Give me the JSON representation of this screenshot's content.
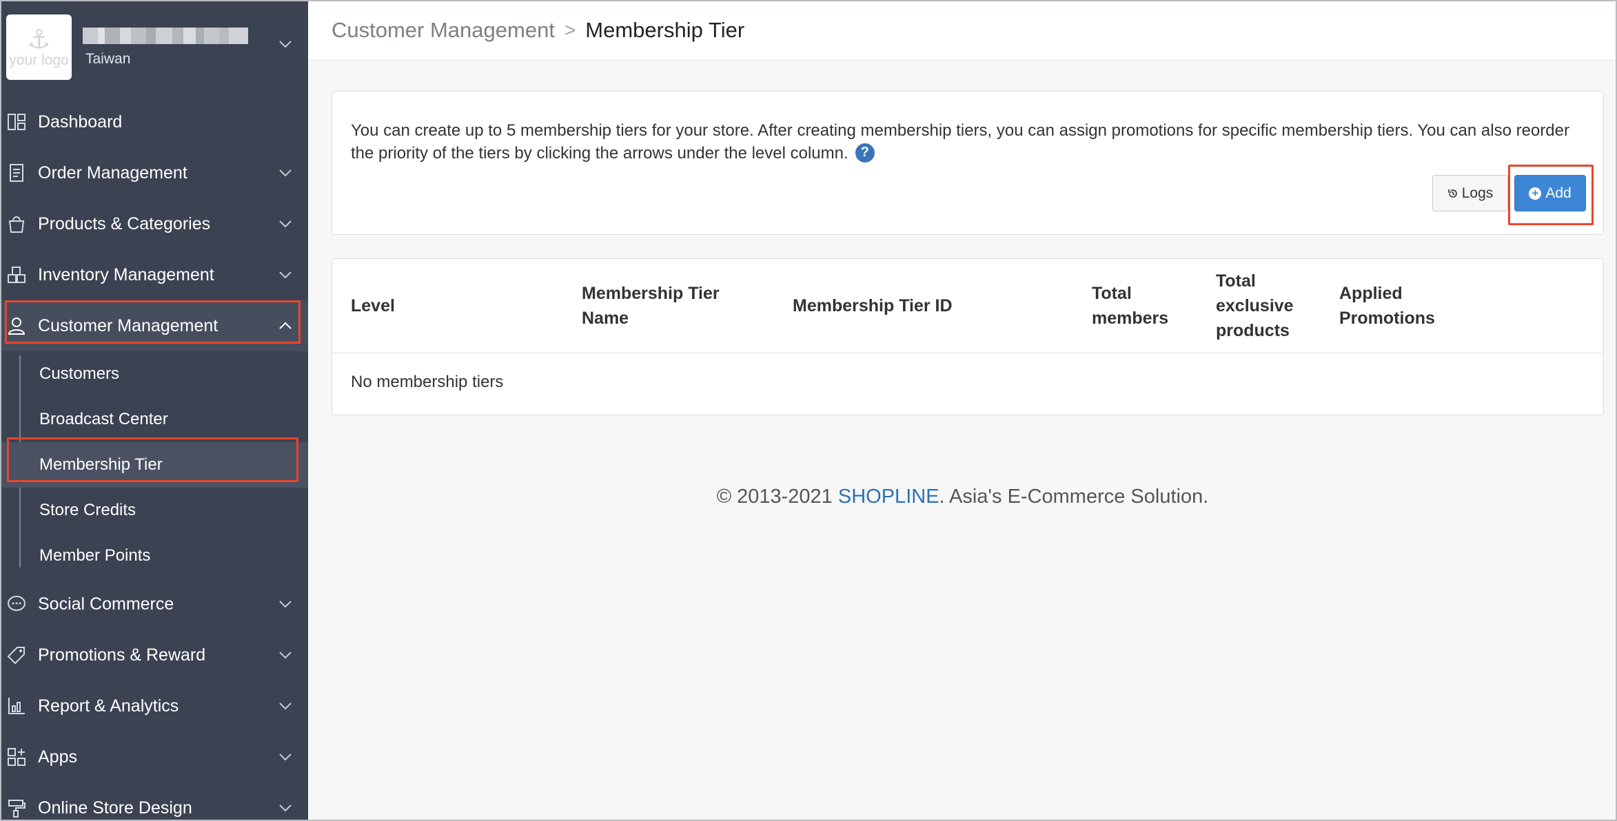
{
  "sidebar": {
    "logo_text": "your logo",
    "store_region": "Taiwan",
    "items": [
      {
        "label": "Dashboard",
        "icon": "dashboard-icon"
      },
      {
        "label": "Order Management",
        "icon": "order-icon"
      },
      {
        "label": "Products & Categories",
        "icon": "shopping-bag-icon"
      },
      {
        "label": "Inventory Management",
        "icon": "inventory-icon"
      },
      {
        "label": "Customer Management",
        "icon": "user-icon"
      },
      {
        "label": "Social Commerce",
        "icon": "chat-icon"
      },
      {
        "label": "Promotions & Reward",
        "icon": "tag-icon"
      },
      {
        "label": "Report & Analytics",
        "icon": "chart-icon"
      },
      {
        "label": "Apps",
        "icon": "apps-icon"
      },
      {
        "label": "Online Store Design",
        "icon": "paint-roller-icon"
      }
    ],
    "customer_submenu": [
      {
        "label": "Customers"
      },
      {
        "label": "Broadcast Center"
      },
      {
        "label": "Membership Tier"
      },
      {
        "label": "Store Credits"
      },
      {
        "label": "Member Points"
      }
    ]
  },
  "breadcrumb": {
    "parent": "Customer Management",
    "separator": ">",
    "current": "Membership Tier"
  },
  "info": {
    "text": "You can create up to 5 membership tiers for your store. After creating membership tiers, you can assign promotions for specific membership tiers. You can also reorder the priority of the tiers by clicking the arrows under the level column.",
    "help_symbol": "?",
    "logs_label": "Logs",
    "add_label": "Add"
  },
  "table": {
    "headers": [
      "Level",
      "Membership Tier Name",
      "Membership Tier ID",
      "Total members",
      "Total exclusive products",
      "Applied Promotions"
    ],
    "empty_text": "No membership tiers"
  },
  "footer": {
    "prefix": "© 2013-2021 ",
    "brand": "SHOPLINE",
    "suffix": ". Asia's E-Commerce Solution."
  },
  "colors": {
    "sidebar_bg": "#3b4252",
    "accent_blue": "#3d86d6",
    "highlight_red": "#e8452c"
  }
}
